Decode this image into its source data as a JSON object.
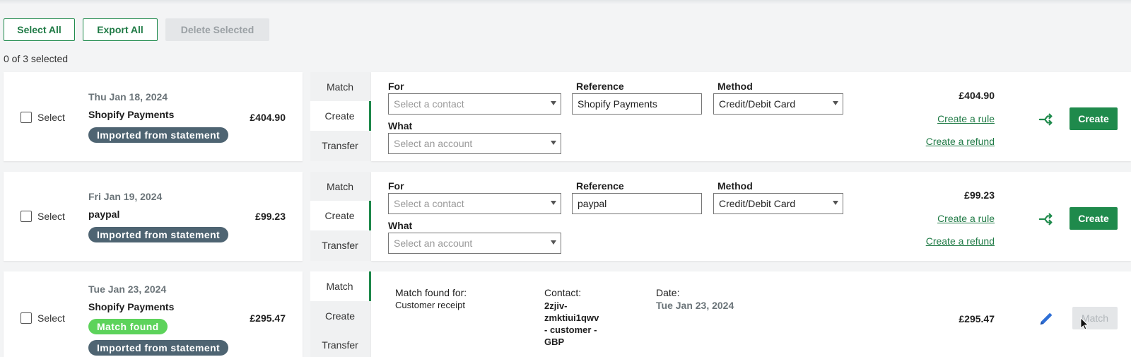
{
  "toolbar": {
    "select_all": "Select All",
    "export_all": "Export All",
    "delete_selected": "Delete Selected",
    "selection_count": "0  of  3  selected"
  },
  "tabs": [
    "Match",
    "Create",
    "Transfer"
  ],
  "checkbox_label": "Select",
  "form_labels": {
    "for": "For",
    "reference": "Reference",
    "method": "Method",
    "what": "What"
  },
  "links": {
    "create_rule": "Create a rule",
    "create_refund": "Create a refund"
  },
  "transactions": [
    {
      "date": "Thu Jan 18, 2024",
      "name": "Shopify Payments",
      "amount": "£404.90",
      "badge": "Imported from statement",
      "active_tab": "Create",
      "contact_placeholder": "Select a contact",
      "reference": "Shopify Payments",
      "method": "Credit/Debit Card",
      "account_placeholder": "Select an account",
      "total": "£404.90",
      "action": "Create"
    },
    {
      "date": "Fri Jan 19, 2024",
      "name": "paypal",
      "amount": "£99.23",
      "badge": "Imported from statement",
      "active_tab": "Create",
      "contact_placeholder": "Select a contact",
      "reference": "paypal",
      "method": "Credit/Debit Card",
      "account_placeholder": "Select an account",
      "total": "£99.23",
      "action": "Create"
    },
    {
      "date": "Tue Jan 23, 2024",
      "name": "Shopify Payments",
      "amount": "£295.47",
      "badge_match": "Match found",
      "badge": "Imported from statement",
      "active_tab": "Match",
      "match_found_label": "Match found for:",
      "match_type": "Customer receipt",
      "contact_label": "Contact:",
      "contact_lines": [
        "2zjiv-",
        "zmktiui1qwv",
        "- customer -",
        "GBP"
      ],
      "date_label": "Date:",
      "match_date": "Tue Jan 23, 2024",
      "total": "£295.47",
      "action": "Match"
    }
  ],
  "colors": {
    "brand_green": "#1f8a4c",
    "badge_statement": "#4e6472",
    "badge_match": "#5dd35b"
  },
  "icons": {
    "shuffle": "shuffle-icon",
    "pencil": "pencil-icon",
    "cursor": "mouse-pointer"
  }
}
